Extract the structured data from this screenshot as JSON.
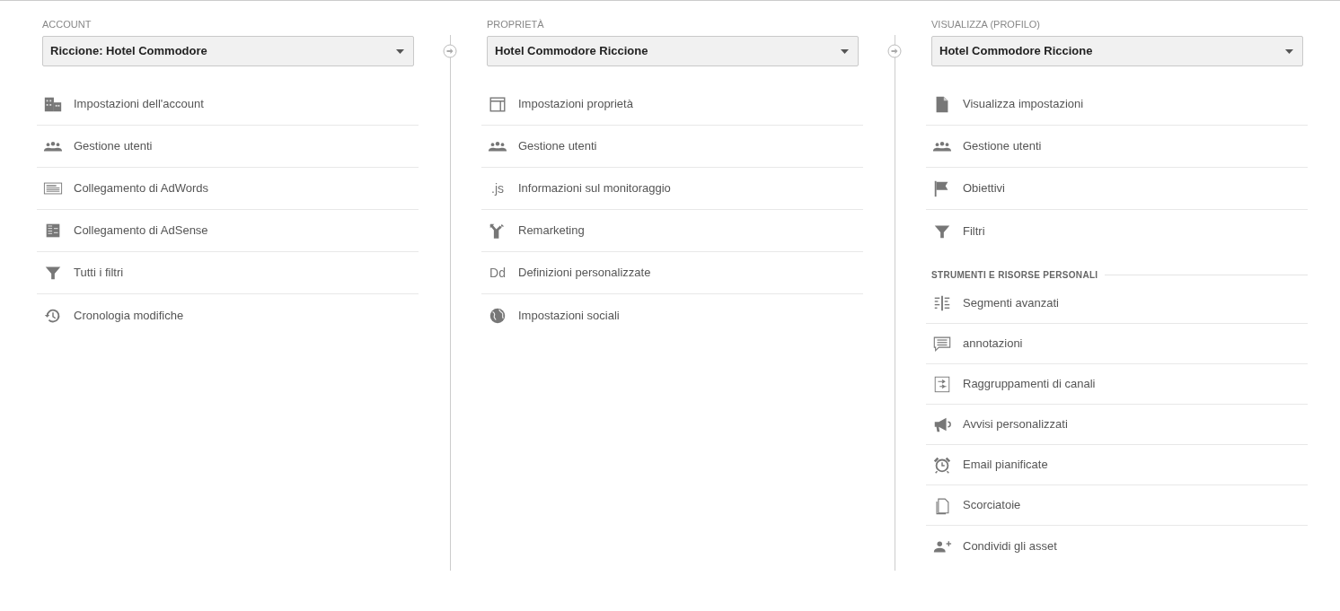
{
  "columns": [
    {
      "heading": "ACCOUNT",
      "dropdown": {
        "value": "Riccione: Hotel Commodore"
      },
      "sections": [
        {
          "items": [
            {
              "kind": "building",
              "label": "Impostazioni dell'account"
            },
            {
              "kind": "people",
              "label": "Gestione utenti"
            },
            {
              "kind": "adwords",
              "label": "Collegamento di AdWords"
            },
            {
              "kind": "adsense",
              "label": "Collegamento di AdSense"
            },
            {
              "kind": "filter",
              "label": "Tutti i filtri"
            },
            {
              "kind": "history",
              "label": "Cronologia modifiche"
            }
          ]
        }
      ]
    },
    {
      "heading": "PROPRIETÀ",
      "dropdown": {
        "value": "Hotel Commodore Riccione"
      },
      "sections": [
        {
          "items": [
            {
              "kind": "layout",
              "label": "Impostazioni proprietà"
            },
            {
              "kind": "people",
              "label": "Gestione utenti"
            },
            {
              "kind": "glyph",
              "glyph": ".js",
              "label": "Informazioni sul monitoraggio"
            },
            {
              "kind": "fork",
              "label": "Remarketing"
            },
            {
              "kind": "glyph",
              "glyph": "Dd",
              "label": "Definizioni personalizzate"
            },
            {
              "kind": "globe",
              "label": "Impostazioni sociali"
            }
          ]
        }
      ]
    },
    {
      "heading": "VISUALIZZA (PROFILO)",
      "dropdown": {
        "value": "Hotel Commodore Riccione"
      },
      "sections": [
        {
          "items": [
            {
              "kind": "document",
              "label": "Visualizza impostazioni"
            },
            {
              "kind": "people",
              "label": "Gestione utenti"
            },
            {
              "kind": "flag",
              "label": "Obiettivi"
            },
            {
              "kind": "filter",
              "label": "Filtri"
            }
          ]
        },
        {
          "title": "STRUMENTI E RISORSE PERSONALI",
          "items": [
            {
              "kind": "segments",
              "label": "Segmenti avanzati"
            },
            {
              "kind": "comment",
              "label": "annotazioni"
            },
            {
              "kind": "channels",
              "label": "Raggruppamenti di canali"
            },
            {
              "kind": "megaphone",
              "label": "Avvisi personalizzati"
            },
            {
              "kind": "alarm",
              "label": "Email pianificate"
            },
            {
              "kind": "copy",
              "label": "Scorciatoie"
            },
            {
              "kind": "person-add",
              "label": "Condividi gli asset"
            }
          ]
        }
      ]
    }
  ]
}
